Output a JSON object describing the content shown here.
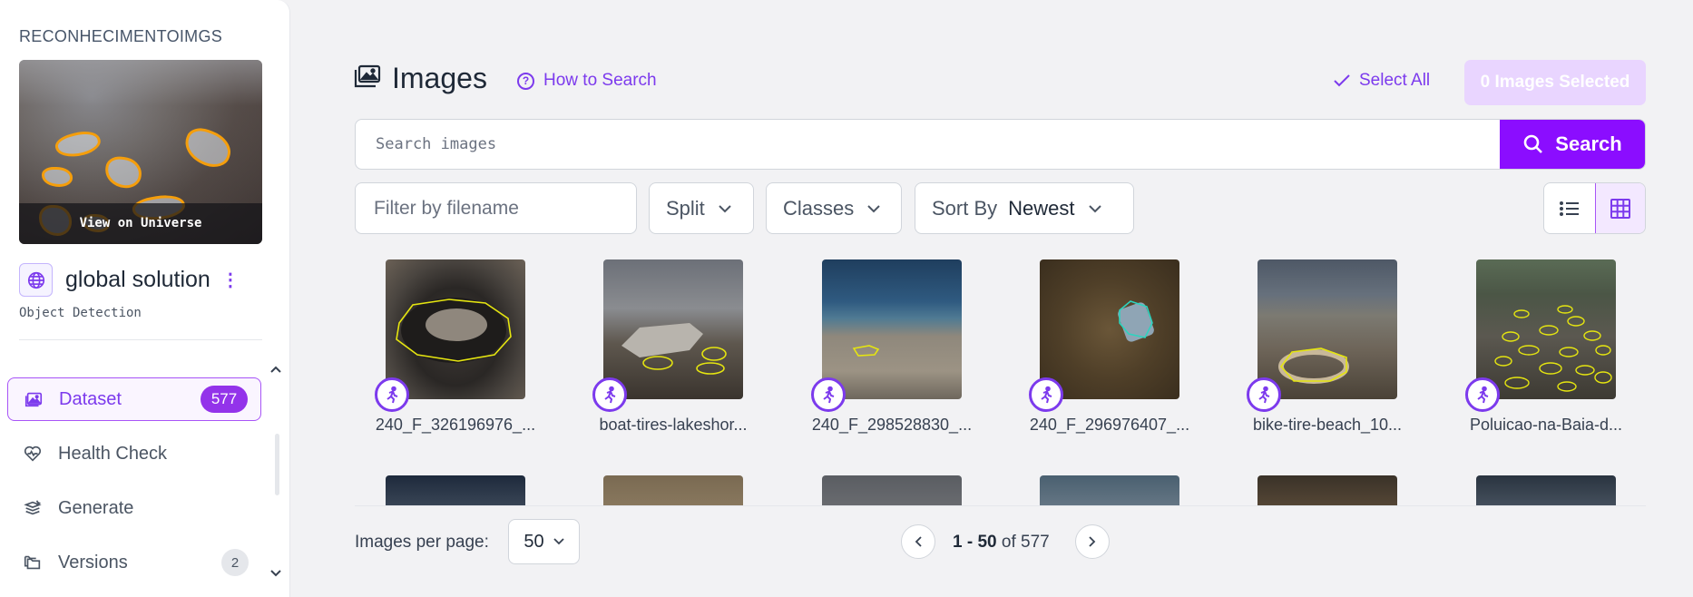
{
  "workspace": {
    "name": "RECONHECIMENTOIMGS"
  },
  "project": {
    "thumbnail_label": "View on Universe",
    "title": "global solution",
    "type": "Object Detection"
  },
  "nav": {
    "items": [
      {
        "label": "Dataset",
        "count": "577",
        "icon": "images-icon",
        "active": true
      },
      {
        "label": "Health Check",
        "count": "",
        "icon": "heart-pulse-icon",
        "active": false
      },
      {
        "label": "Generate",
        "count": "",
        "icon": "layers-icon",
        "active": false
      },
      {
        "label": "Versions",
        "count": "2",
        "icon": "folders-icon",
        "active": false
      }
    ]
  },
  "header": {
    "title": "Images",
    "how_to_search": "How to Search",
    "select_all": "Select All",
    "selected_count": "0 Images Selected"
  },
  "search": {
    "placeholder": "Search images",
    "button_label": "Search"
  },
  "filters": {
    "filename_placeholder": "Filter by filename",
    "split_label": "Split",
    "classes_label": "Classes",
    "sort_label": "Sort By",
    "sort_value": "Newest"
  },
  "images": [
    {
      "filename": "240_F_326196976_..."
    },
    {
      "filename": "boat-tires-lakeshor..."
    },
    {
      "filename": "240_F_298528830_..."
    },
    {
      "filename": "240_F_296976407_..."
    },
    {
      "filename": "bike-tire-beach_10..."
    },
    {
      "filename": "Poluicao-na-Baia-d..."
    }
  ],
  "pagination": {
    "per_page_label": "Images per page:",
    "per_page_value": "50",
    "range": "1 - 50",
    "of_label": "of",
    "total": "577"
  },
  "colors": {
    "accent": "#7c3aed",
    "search_button": "#8b0dff",
    "annotation_yellow": "#e5e510",
    "annotation_teal": "#2dd4bf",
    "thumbnail_annotation": "#f59e0b"
  }
}
